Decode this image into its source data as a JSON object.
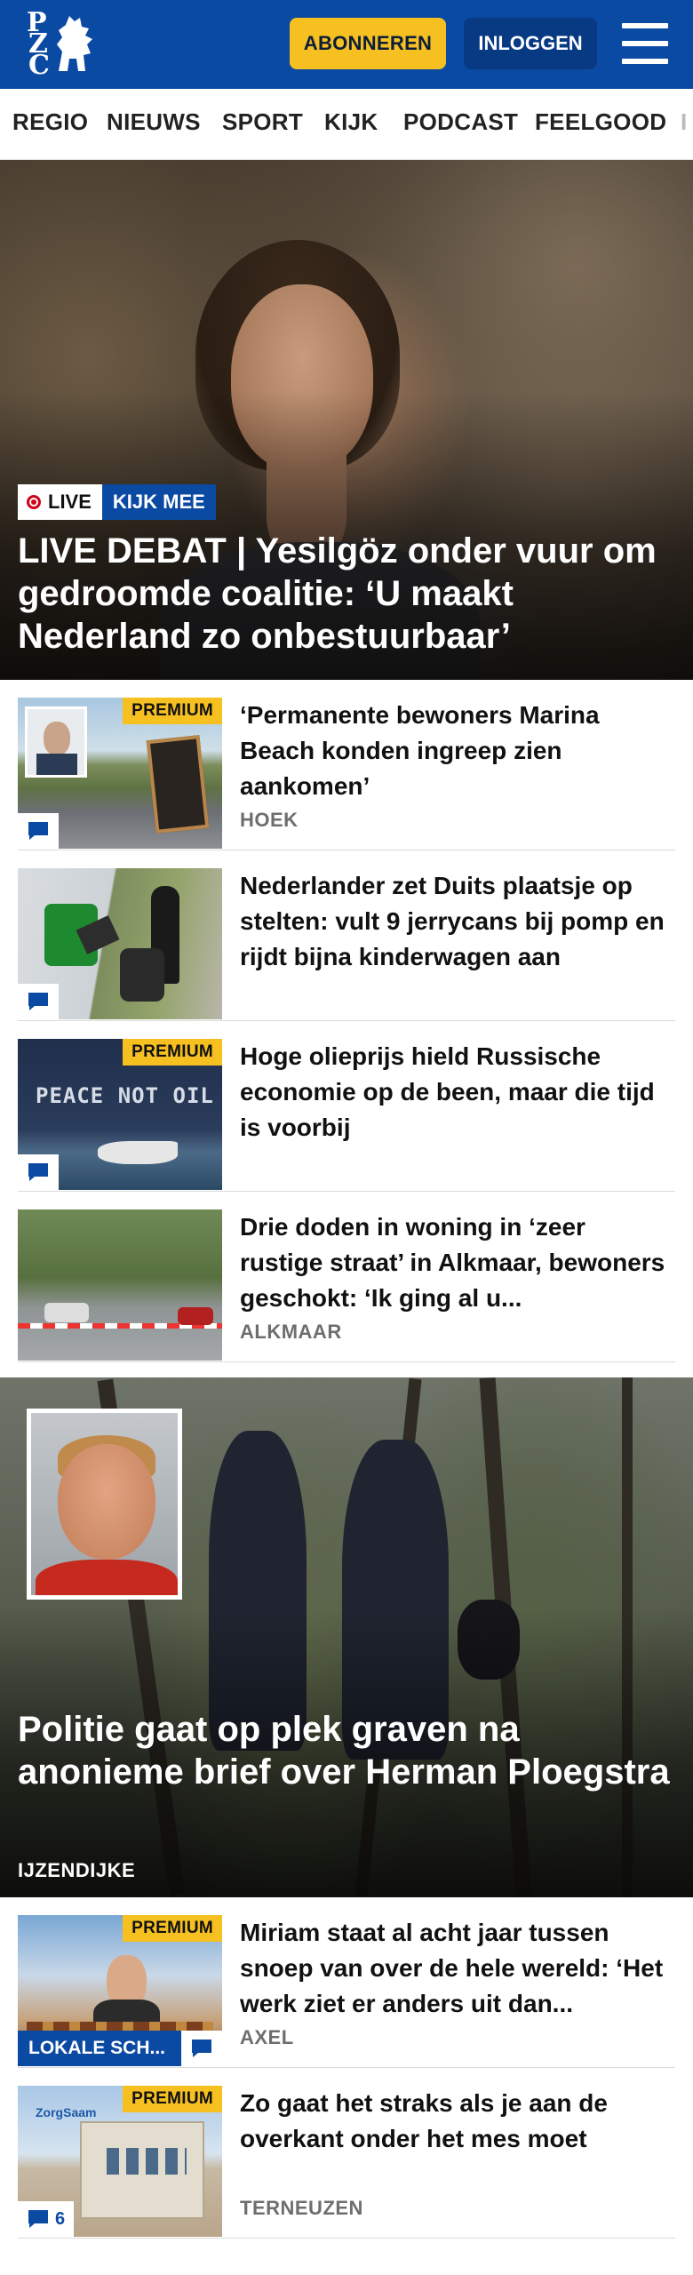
{
  "header": {
    "logo_letters": [
      "P",
      "Z",
      "C"
    ],
    "subscribe_label": "ABONNEREN",
    "login_label": "INLOGGEN",
    "brand_color": "#0b4aa3",
    "accent_color": "#f6c021"
  },
  "nav": {
    "items": [
      "REGIO",
      "NIEUWS",
      "SPORT",
      "KIJK",
      "PODCAST",
      "FEELGOOD",
      "I"
    ]
  },
  "hero": {
    "live_label": "LIVE",
    "watch_label": "KIJK MEE",
    "title": "LIVE DEBAT | Yesilgöz onder vuur om gedroomde coalitie: ‘U maakt Nederland zo onbestuurbaar’"
  },
  "articles": [
    {
      "premium": "PREMIUM",
      "title": "‘Permanente bewoners Marina Beach konden ingreep zien aankomen’",
      "meta": "HOEK",
      "comment_icon": "comment-icon"
    },
    {
      "title": "Nederlander zet Duits plaatsje op stelten: vult 9 jerrycans bij pomp en rijdt bijna kinderwagen aan",
      "comment_icon": "comment-icon"
    },
    {
      "premium": "PREMIUM",
      "title": "Hoge olieprijs hield Russische economie op de been, maar die tijd is voorbij",
      "comment_icon": "comment-icon"
    },
    {
      "title": "Drie doden in woning in ‘zeer rustige straat’ in Alkmaar, bewoners geschokt: ‘Ik ging al u...",
      "meta": "ALKMAAR"
    }
  ],
  "hero2": {
    "title": "Politie gaat op plek graven na anonieme brief over Herman Ploegstra",
    "meta": "IJZENDIJKE"
  },
  "articles2": [
    {
      "premium": "PREMIUM",
      "local_tag": "LOKALE SCH...",
      "title": "Miriam staat al acht jaar tussen snoep van over de hele wereld: ‘Het werk ziet er anders uit dan...",
      "meta": "AXEL",
      "comment_icon": "comment-icon"
    },
    {
      "premium": "PREMIUM",
      "title": "Zo gaat het straks als je aan de overkant onder het mes moet",
      "meta": "TERNEUZEN",
      "comment_count": "6"
    }
  ]
}
